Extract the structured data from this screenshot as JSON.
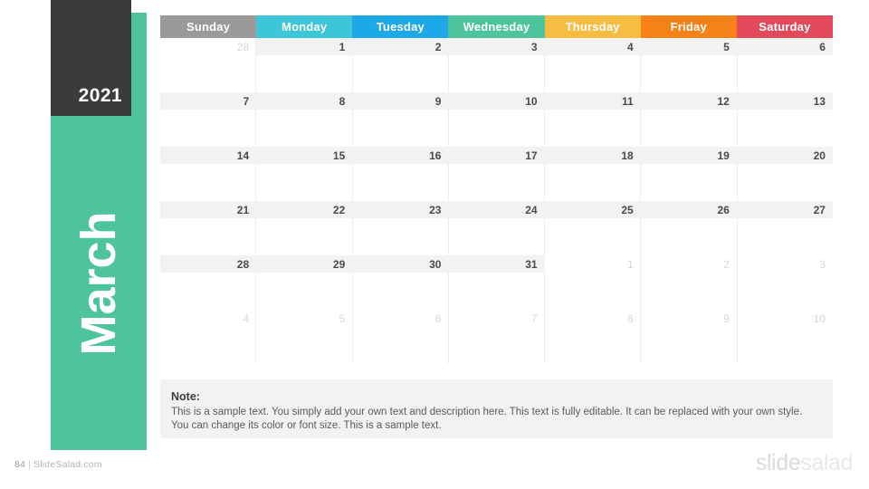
{
  "slide": {
    "background": "#ffffff"
  },
  "sidebar": {
    "year": "2021",
    "month": "March",
    "green_color": "#4ec49a",
    "dark_color": "#3b3b3b"
  },
  "calendar": {
    "day_headers": [
      {
        "label": "Sunday",
        "color": "#9a9a9a"
      },
      {
        "label": "Monday",
        "color": "#3dc6d8"
      },
      {
        "label": "Tuesday",
        "color": "#1da9e8"
      },
      {
        "label": "Wednesday",
        "color": "#4ec49a"
      },
      {
        "label": "Thursday",
        "color": "#f8bc42"
      },
      {
        "label": "Friday",
        "color": "#f58216"
      },
      {
        "label": "Saturday",
        "color": "#e24a5c"
      }
    ],
    "weeks": [
      {
        "days": [
          {
            "num": "28",
            "muted": true,
            "band": false
          },
          {
            "num": "1",
            "muted": false,
            "band": true
          },
          {
            "num": "2",
            "muted": false,
            "band": true
          },
          {
            "num": "3",
            "muted": false,
            "band": true
          },
          {
            "num": "4",
            "muted": false,
            "band": true
          },
          {
            "num": "5",
            "muted": false,
            "band": true
          },
          {
            "num": "6",
            "muted": false,
            "band": true
          }
        ]
      },
      {
        "days": [
          {
            "num": "7",
            "muted": false,
            "band": true
          },
          {
            "num": "8",
            "muted": false,
            "band": true
          },
          {
            "num": "9",
            "muted": false,
            "band": true
          },
          {
            "num": "10",
            "muted": false,
            "band": true
          },
          {
            "num": "11",
            "muted": false,
            "band": true
          },
          {
            "num": "12",
            "muted": false,
            "band": true
          },
          {
            "num": "13",
            "muted": false,
            "band": true
          }
        ]
      },
      {
        "days": [
          {
            "num": "14",
            "muted": false,
            "band": true
          },
          {
            "num": "15",
            "muted": false,
            "band": true
          },
          {
            "num": "16",
            "muted": false,
            "band": true
          },
          {
            "num": "17",
            "muted": false,
            "band": true
          },
          {
            "num": "18",
            "muted": false,
            "band": true
          },
          {
            "num": "19",
            "muted": false,
            "band": true
          },
          {
            "num": "20",
            "muted": false,
            "band": true
          }
        ]
      },
      {
        "days": [
          {
            "num": "21",
            "muted": false,
            "band": true
          },
          {
            "num": "22",
            "muted": false,
            "band": true
          },
          {
            "num": "23",
            "muted": false,
            "band": true
          },
          {
            "num": "24",
            "muted": false,
            "band": true
          },
          {
            "num": "25",
            "muted": false,
            "band": true
          },
          {
            "num": "26",
            "muted": false,
            "band": true
          },
          {
            "num": "27",
            "muted": false,
            "band": true
          }
        ]
      },
      {
        "days": [
          {
            "num": "28",
            "muted": false,
            "band": true
          },
          {
            "num": "29",
            "muted": false,
            "band": true
          },
          {
            "num": "30",
            "muted": false,
            "band": true
          },
          {
            "num": "31",
            "muted": false,
            "band": true
          },
          {
            "num": "1",
            "muted": true,
            "band": false
          },
          {
            "num": "2",
            "muted": true,
            "band": false
          },
          {
            "num": "3",
            "muted": true,
            "band": false
          }
        ]
      },
      {
        "days": [
          {
            "num": "4",
            "muted": true,
            "band": false
          },
          {
            "num": "5",
            "muted": true,
            "band": false
          },
          {
            "num": "6",
            "muted": true,
            "band": false
          },
          {
            "num": "7",
            "muted": true,
            "band": false
          },
          {
            "num": "8",
            "muted": true,
            "band": false
          },
          {
            "num": "9",
            "muted": true,
            "band": false
          },
          {
            "num": "10",
            "muted": true,
            "band": false
          }
        ]
      }
    ]
  },
  "note": {
    "title": "Note:",
    "body": "This is a sample text. You simply add your own text and description here. This text is fully editable. It can be replaced with your own style. You can change its color or font size. This is a sample text."
  },
  "footer": {
    "page_number": "84",
    "separator": "|",
    "site": "SlideSalad.com",
    "logo_part1": "slide",
    "logo_part2": "salad"
  }
}
